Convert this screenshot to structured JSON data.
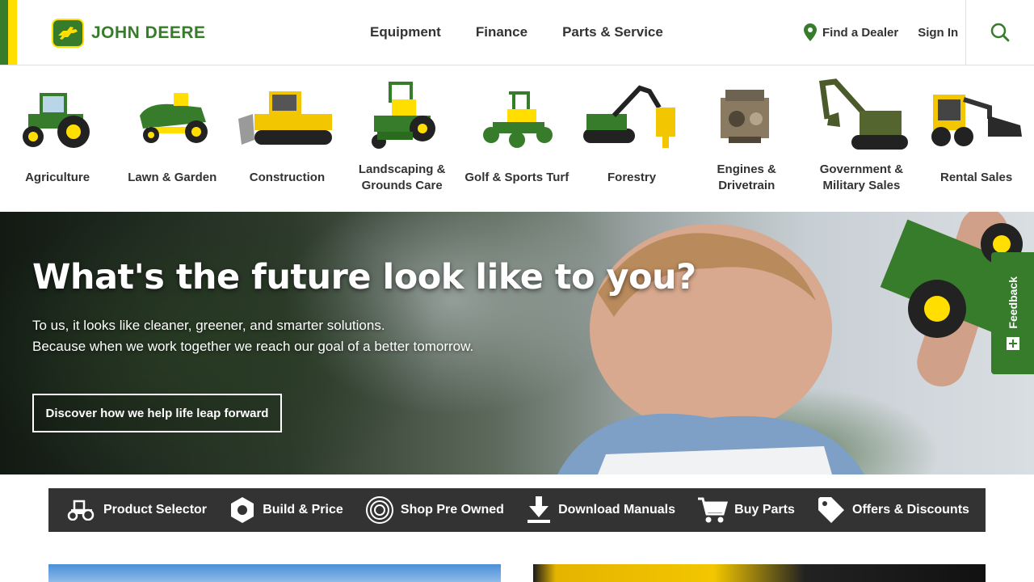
{
  "brand": {
    "name": "JOHN DEERE",
    "green": "#367c2b",
    "yellow": "#ffde00"
  },
  "nav": {
    "items": [
      "Equipment",
      "Finance",
      "Parts & Service"
    ],
    "find_dealer": "Find a Dealer",
    "sign_in": "Sign In",
    "search_icon": "magnifier-icon"
  },
  "categories": [
    {
      "label": "Agriculture",
      "icon": "tractor"
    },
    {
      "label": "Lawn & Garden",
      "icon": "riding-mower"
    },
    {
      "label": "Construction",
      "icon": "bulldozer"
    },
    {
      "label": "Landscaping & Grounds Care",
      "icon": "zero-turn-mower"
    },
    {
      "label": "Golf & Sports Turf",
      "icon": "reel-mower"
    },
    {
      "label": "Forestry",
      "icon": "harvester"
    },
    {
      "label": "Engines & Drivetrain",
      "icon": "engine"
    },
    {
      "label": "Government & Military Sales",
      "icon": "excavator"
    },
    {
      "label": "Rental Sales",
      "icon": "skid-steer"
    }
  ],
  "hero": {
    "title": "What's the future look like to you?",
    "line1": "To us, it looks like cleaner, greener, and smarter solutions.",
    "line2": "Because when we work together we reach our goal of a better tomorrow.",
    "cta": "Discover how we help life leap forward"
  },
  "feedback": {
    "label": "Feedback"
  },
  "quick_links": [
    {
      "label": "Product Selector",
      "icon": "tractor-icon"
    },
    {
      "label": "Build & Price",
      "icon": "hexagon-nut-icon"
    },
    {
      "label": "Shop Pre Owned",
      "icon": "circle-swirl-icon"
    },
    {
      "label": "Download Manuals",
      "icon": "download-icon"
    },
    {
      "label": "Buy Parts",
      "icon": "cart-icon"
    },
    {
      "label": "Offers & Discounts",
      "icon": "tag-icon"
    }
  ]
}
